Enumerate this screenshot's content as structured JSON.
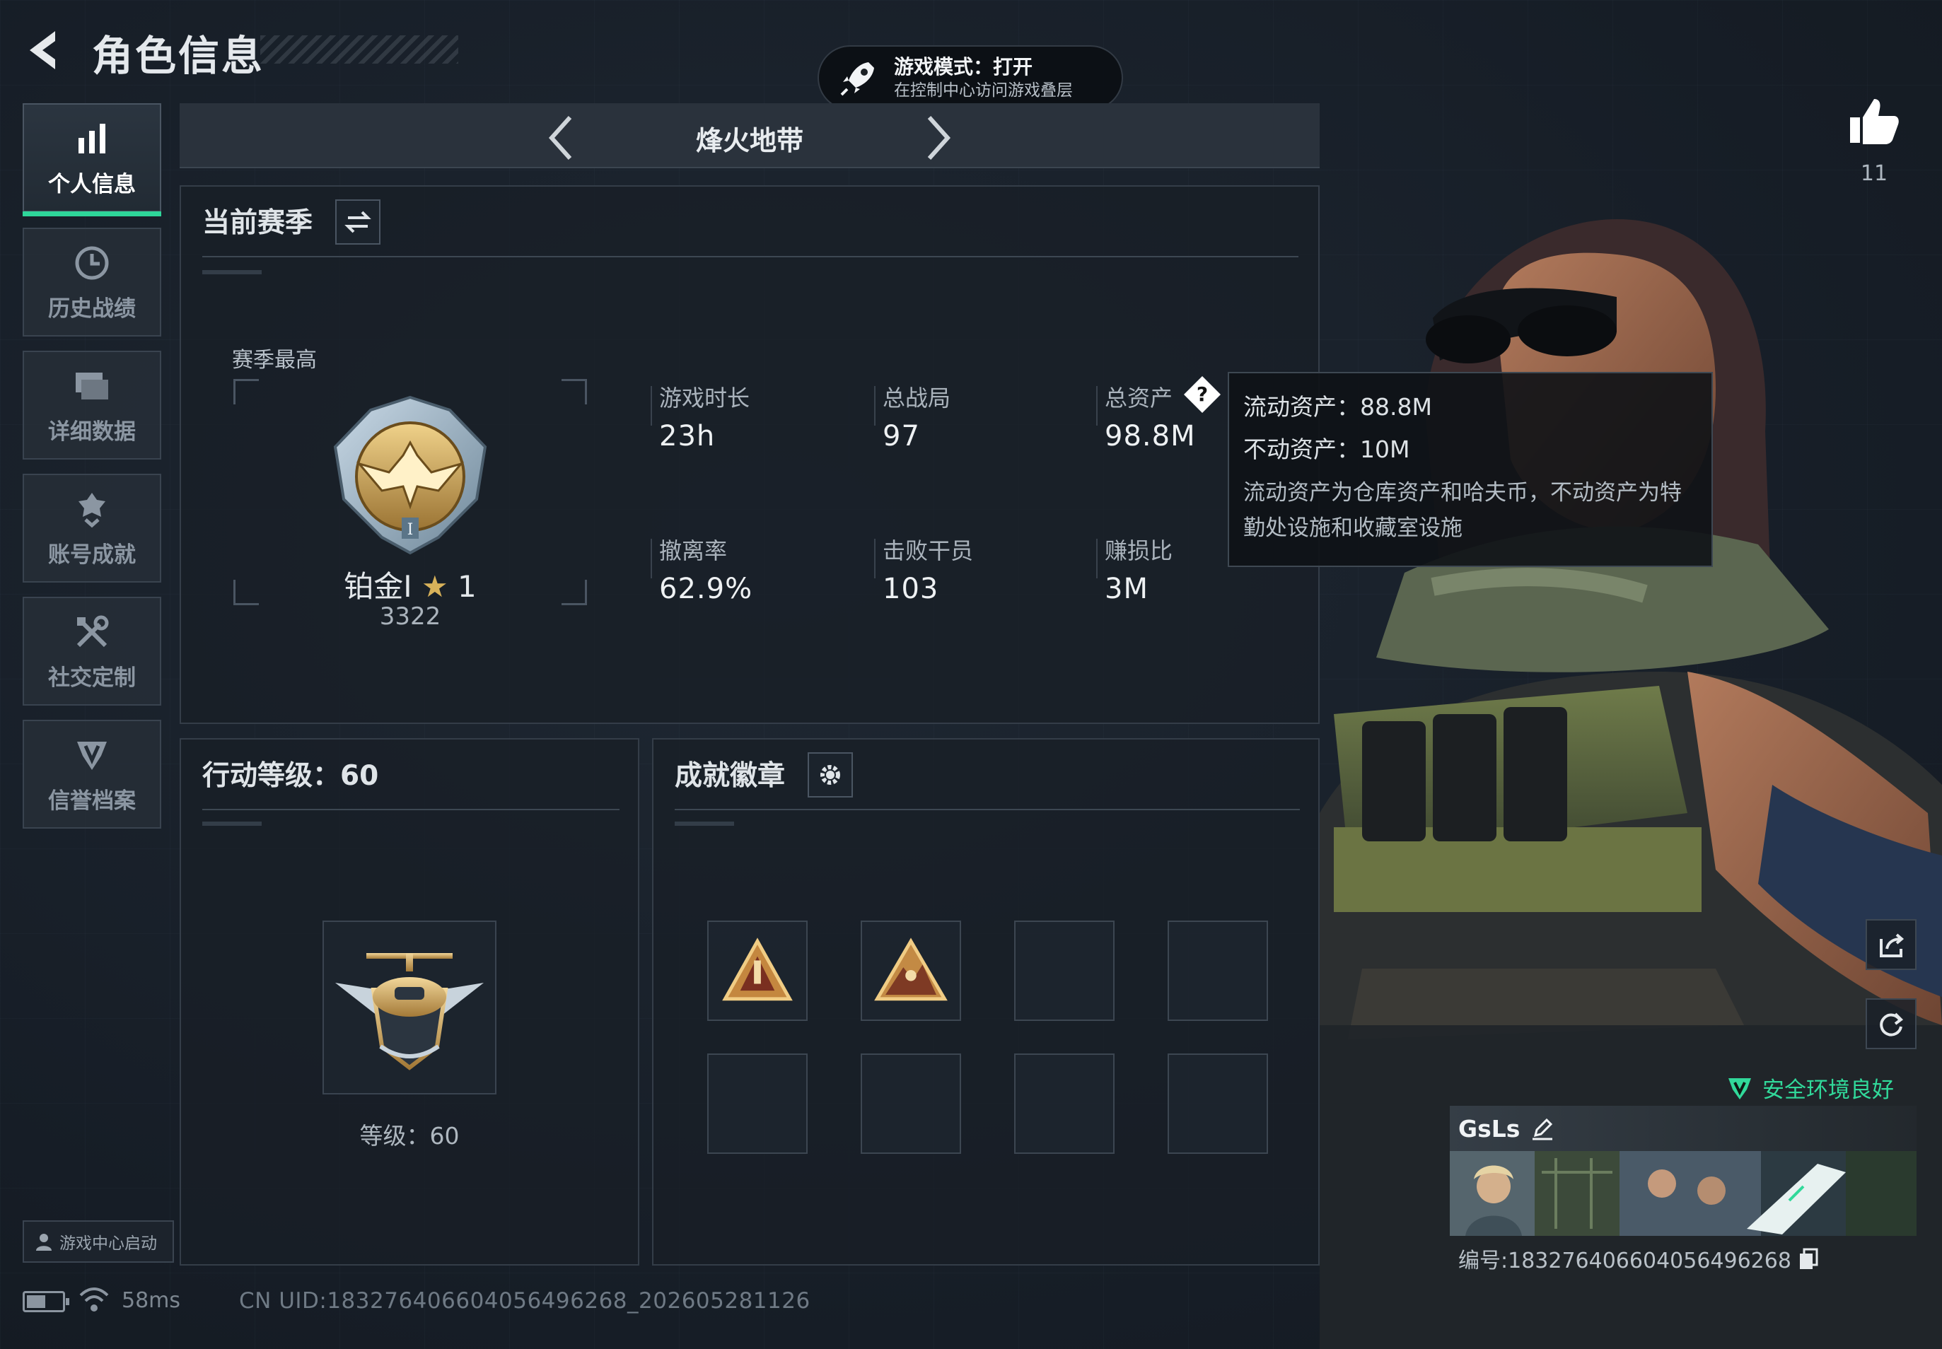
{
  "header": {
    "title": "角色信息"
  },
  "toast": {
    "title": "游戏模式：打开",
    "subtitle": "在控制中心访问游戏叠层"
  },
  "sidebar": {
    "items": [
      {
        "label": "个人信息",
        "icon": "bar-chart-icon",
        "active": true
      },
      {
        "label": "历史战绩",
        "icon": "history-clock-icon"
      },
      {
        "label": "详细数据",
        "icon": "folder-stack-icon"
      },
      {
        "label": "账号成就",
        "icon": "achievement-medal-icon"
      },
      {
        "label": "社交定制",
        "icon": "tools-icon"
      },
      {
        "label": "信誉档案",
        "icon": "shield-badge-icon"
      }
    ],
    "launch_label": "游戏中心启动"
  },
  "mode": {
    "title": "烽火地带"
  },
  "season": {
    "title": "当前赛季",
    "best_label": "赛季最高",
    "rank_name": "铂金I",
    "rank_stars": "1",
    "rank_score": "3322",
    "stats": [
      {
        "label": "游戏时长",
        "value": "23h"
      },
      {
        "label": "总战局",
        "value": "97"
      },
      {
        "label": "总资产",
        "value": "98.8M"
      },
      {
        "label": "撤离率",
        "value": "62.9%"
      },
      {
        "label": "击败干员",
        "value": "103"
      },
      {
        "label": "赚损比",
        "value": "3M"
      }
    ]
  },
  "tooltip": {
    "liquid": "流动资产：88.8M",
    "fixed": "不动资产：10M",
    "note": "流动资产为仓库资产和哈夫币，不动资产为特勤处设施和收藏室设施"
  },
  "level": {
    "title": "行动等级：60",
    "label": "等级：60",
    "value": 60
  },
  "badges": {
    "title": "成就徽章",
    "slots_filled": 2,
    "slots_total": 8
  },
  "profile": {
    "likes": "11",
    "safe_text": "安全环境良好",
    "name": "GsLs",
    "id_text": "编号:18327640660405649626​8"
  },
  "footer": {
    "battery_level": 0.55,
    "ping": "58ms",
    "uid": "CN UID:18327640660405649626​8_202605281126"
  },
  "colors": {
    "accent": "#2ed69a",
    "panel_bg": "#181f27",
    "gold": "#c9a25a"
  }
}
